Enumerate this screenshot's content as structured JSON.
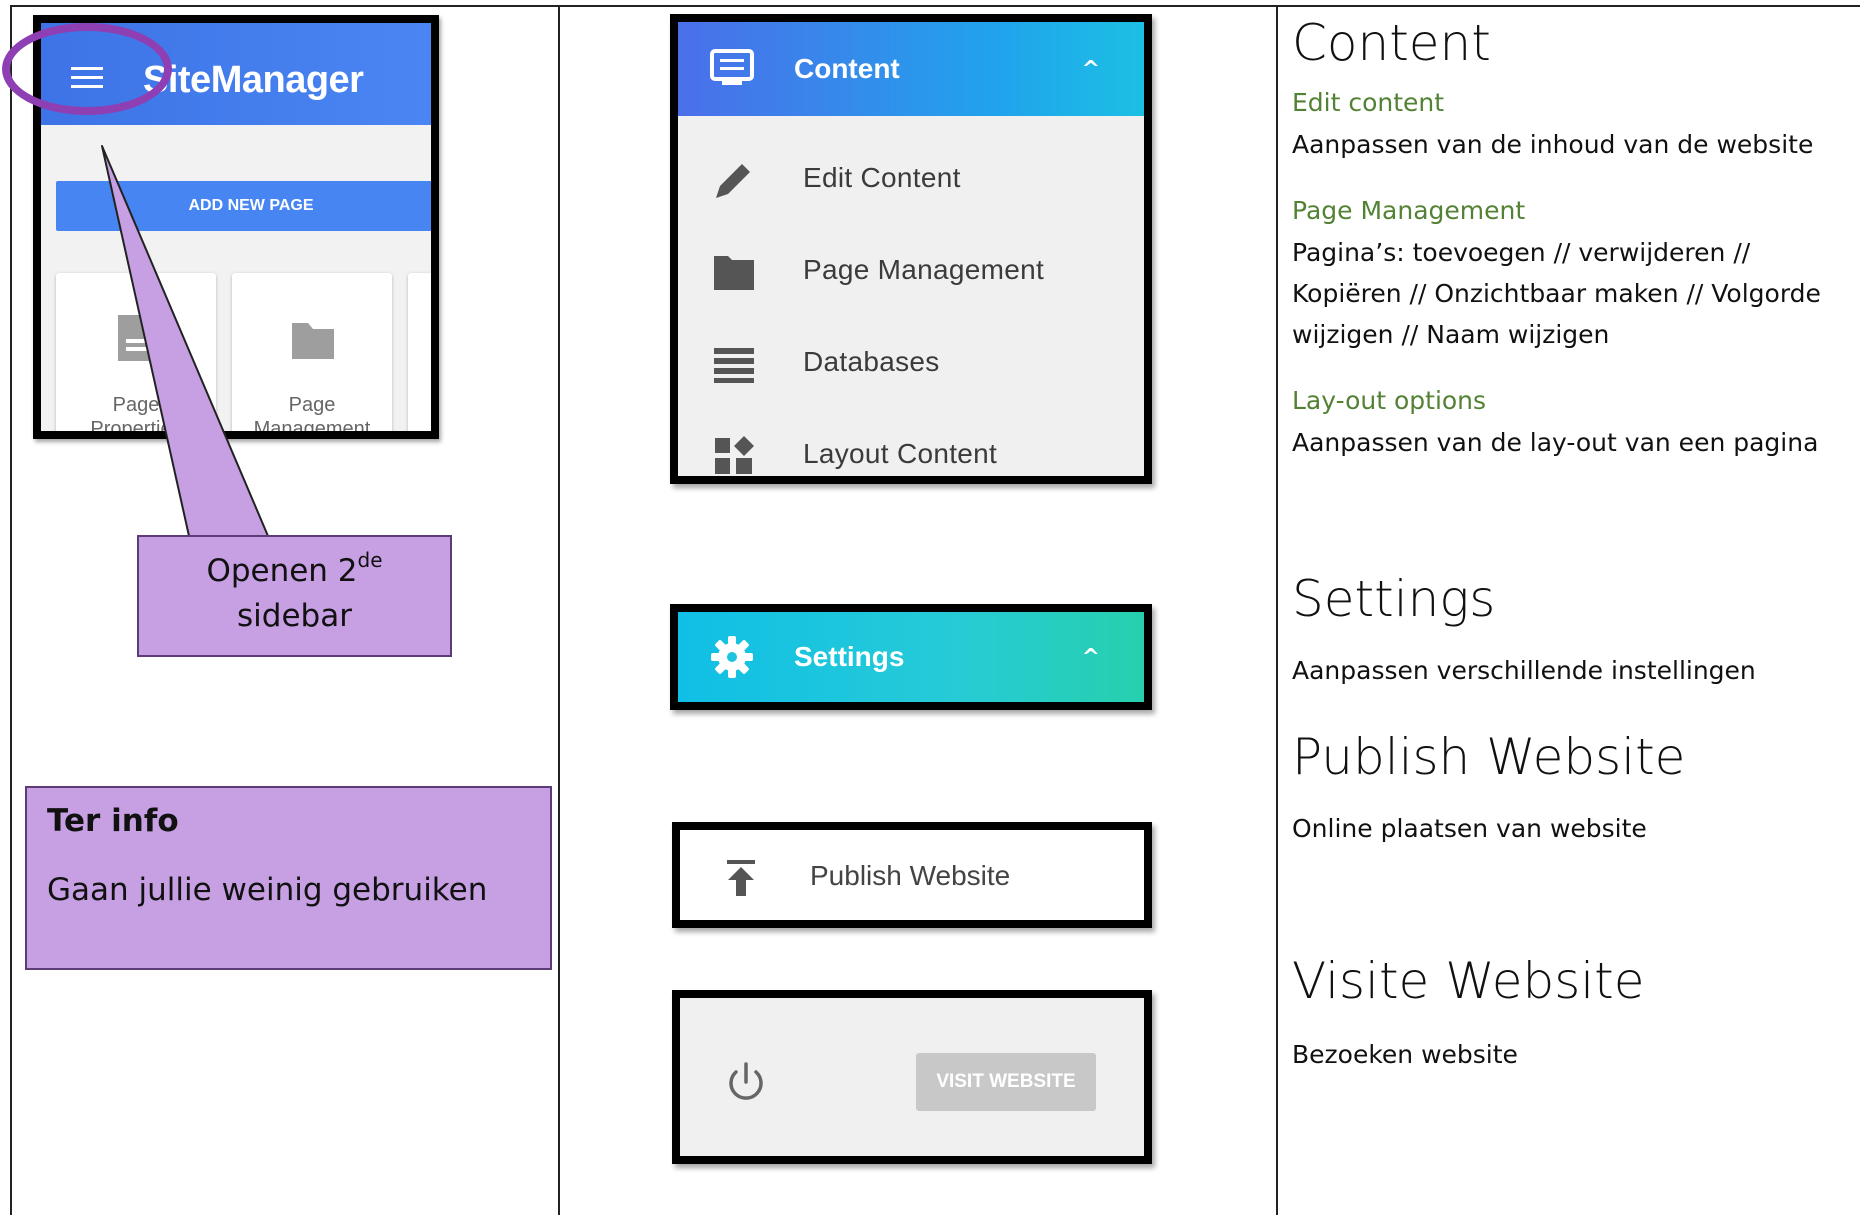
{
  "left_panel": {
    "app_title": "SiteManager",
    "add_page_button": "ADD NEW PAGE",
    "cards": [
      {
        "label_line1": "Page",
        "label_line2": "Properties"
      },
      {
        "label_line1": "Page",
        "label_line2": "Management"
      }
    ],
    "callout": {
      "text": "Openen 2",
      "superscript": "de",
      "text_line2": "sidebar"
    },
    "info": {
      "title": "Ter info",
      "text": "Gaan jullie weinig gebruiken"
    }
  },
  "middle_panel": {
    "content_menu": {
      "header": "Content",
      "items": [
        {
          "label": "Edit Content",
          "icon": "pencil-icon"
        },
        {
          "label": "Page Management",
          "icon": "folder-icon"
        },
        {
          "label": "Databases",
          "icon": "list-icon"
        },
        {
          "label": "Layout Content",
          "icon": "widgets-icon"
        }
      ]
    },
    "settings_menu": {
      "header": "Settings"
    },
    "publish": {
      "label": "Publish Website"
    },
    "visit": {
      "button": "VISIT WEBSITE"
    }
  },
  "right_panel": {
    "content": {
      "title": "Content",
      "edit_sub": "Edit content",
      "edit_text": "Aanpassen van de inhoud van de website",
      "page_sub": "Page Management",
      "page_text": "Pagina’s: toevoegen // verwijderen // Kopiëren // Onzichtbaar maken // Volgorde wijzigen // Naam wijzigen",
      "layout_sub": "Lay-out options",
      "layout_text": "Aanpassen van de lay-out van een pagina"
    },
    "settings": {
      "title": "Settings",
      "text": "Aanpassen verschillende instellingen"
    },
    "publish": {
      "title": "Publish Website",
      "text": "Online plaatsen van website"
    },
    "visit": {
      "title": "Visite Website",
      "text": "Bezoeken website"
    }
  },
  "colors": {
    "annotation_purple": "#c7a0e3",
    "ring_purple": "#8e3fb3",
    "sub_heading_green": "#548235",
    "app_blue": "#4785f2"
  }
}
